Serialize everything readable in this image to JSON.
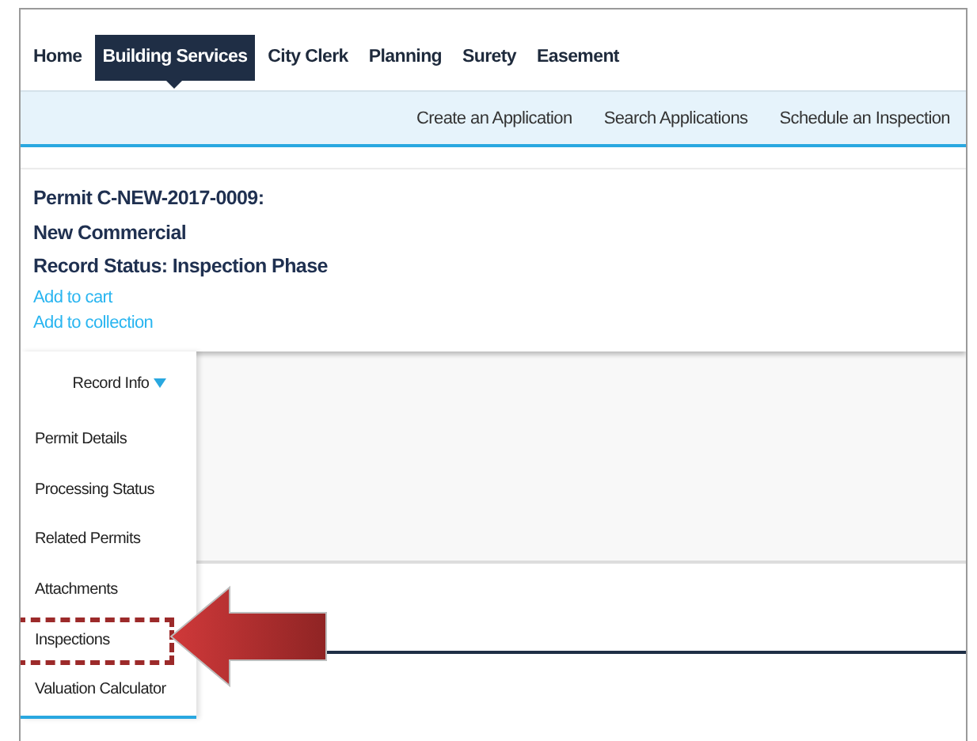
{
  "top_nav": {
    "tabs": [
      {
        "label": "Home",
        "selected": false
      },
      {
        "label": "Building Services",
        "selected": true
      },
      {
        "label": "City Clerk",
        "selected": false
      },
      {
        "label": "Planning",
        "selected": false
      },
      {
        "label": "Surety",
        "selected": false
      },
      {
        "label": "Easement",
        "selected": false
      }
    ]
  },
  "sub_nav": {
    "links": [
      "Create an Application",
      "Search Applications",
      "Schedule an Inspection"
    ]
  },
  "record": {
    "title_lines": [
      "Permit C-NEW-2017-0009:",
      "New Commercial",
      "Record Status: Inspection Phase"
    ],
    "links": [
      "Add to cart",
      "Add to collection"
    ]
  },
  "sidebar": {
    "header": "Record Info",
    "expanded": true,
    "items": [
      {
        "label": "Permit Details",
        "highlighted": false
      },
      {
        "label": "Processing Status",
        "highlighted": false
      },
      {
        "label": "Related Permits",
        "highlighted": false
      },
      {
        "label": "Attachments",
        "highlighted": false
      },
      {
        "label": "Inspections",
        "highlighted": true
      },
      {
        "label": "Valuation Calculator",
        "highlighted": false
      }
    ]
  }
}
